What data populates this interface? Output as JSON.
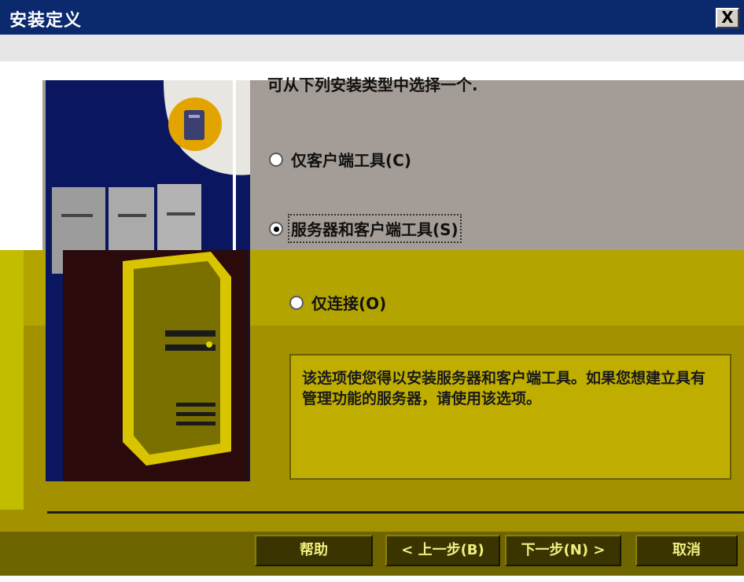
{
  "window": {
    "title": "安装定义",
    "close_label": "X"
  },
  "prompt": "可从下列安装类型中选择一个.",
  "options": [
    {
      "label": "仅客户端工具(C)",
      "selected": false
    },
    {
      "label": "服务器和客户端工具(S)",
      "selected": true
    },
    {
      "label": "仅连接(O)",
      "selected": false
    }
  ],
  "description": "该选项使您得以安装服务器和客户端工具。如果您想建立具有管理功能的服务器，请使用该选项。",
  "buttons": {
    "help": "帮助",
    "back": "< 上一步(B)",
    "next": "下一步(N) >",
    "cancel": "取消"
  },
  "colors": {
    "title_bar": "#0b2a6e",
    "upper_panel": "#a49c96",
    "lower_panel": "#a49100"
  },
  "icons": {
    "art": "server-tower-illustration"
  }
}
